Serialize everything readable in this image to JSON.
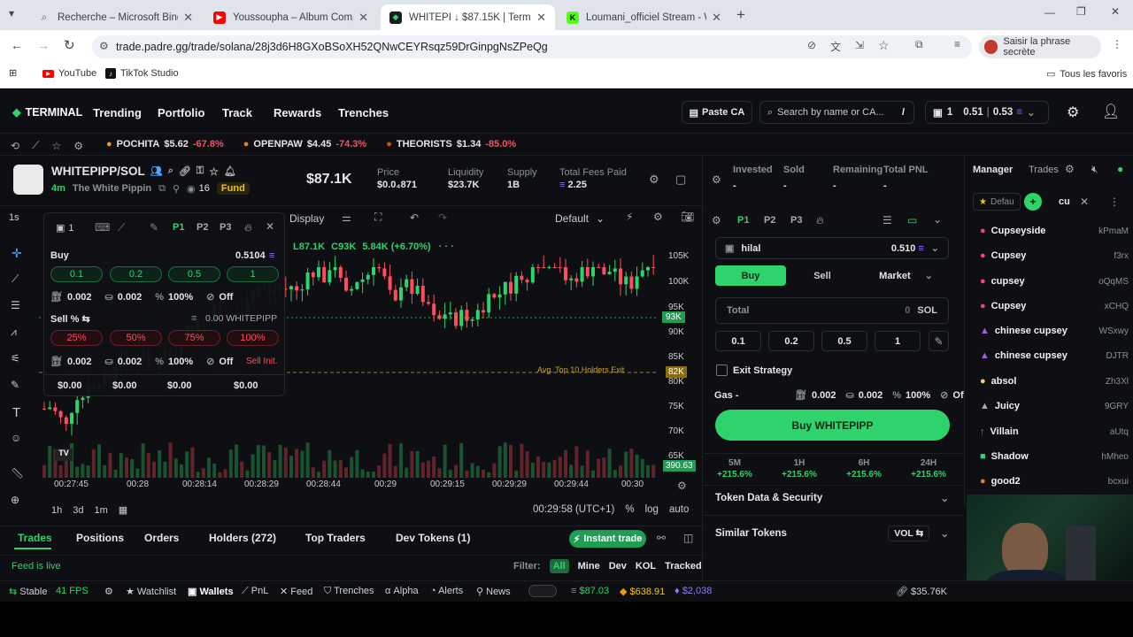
{
  "browser": {
    "tabs": [
      {
        "title": "Recherche – Microsoft Bing",
        "close": "✕"
      },
      {
        "title": "Youssoupha – Album Complet",
        "close": "✕"
      },
      {
        "title": "WHITEPI ↓ $87.15K | Terminal",
        "close": "✕"
      },
      {
        "title": "Loumani_officiel Stream - Watc",
        "close": "✕"
      }
    ],
    "new_tab": "+",
    "url": "trade.padre.gg/trade/solana/28j3d6H8GXoBSoXH52QNwCEYRsqz59DrGinpgNsZPeQg",
    "profile_button": "Saisir la phrase secrète",
    "bookmarks": [
      "YouTube",
      "TikTok Studio"
    ],
    "all_bookmarks": "Tous les favoris"
  },
  "nav": {
    "brand": "TERMINAL",
    "links": [
      "Trending",
      "Portfolio",
      "Track",
      "Rewards",
      "Trenches"
    ],
    "paste": "Paste CA",
    "search_placeholder": "Search by name or CA...",
    "shortcut": "/",
    "wallet_count": "1",
    "sol_balance": "0.51",
    "sol_balance2": "0.53"
  },
  "ticker": [
    {
      "name": "POCHITA",
      "price": "$5.62",
      "change": "-67.8%"
    },
    {
      "name": "OPENPAW",
      "price": "$4.45",
      "change": "-74.3%"
    },
    {
      "name": "THEORISTS",
      "price": "$1.34",
      "change": "-85.0%"
    }
  ],
  "token": {
    "pair": "WHITEPIPP/SOL",
    "age": "4m",
    "name": "The White Pippin",
    "holders_eye": "16",
    "fund": "Fund",
    "mcap": "$87.1K",
    "stats": [
      {
        "label": "Price",
        "value": "$0.0₄871"
      },
      {
        "label": "Liquidity",
        "value": "$23.7K"
      },
      {
        "label": "Supply",
        "value": "1B"
      },
      {
        "label": "Total Fees Paid",
        "value": "2.25"
      }
    ]
  },
  "chart_toolbar": {
    "interval": "1s",
    "display": "Display",
    "template": "Default"
  },
  "chart_legend": {
    "low": "L87.1K",
    "close": "C93K",
    "change": "5.84K (+6.70%)"
  },
  "y_ticks": [
    "105K",
    "100K",
    "95K",
    "90K",
    "85K",
    "80K",
    "75K",
    "70K",
    "65K"
  ],
  "price_tag": "93K",
  "avg_tag": "82K",
  "vol_tag": "390.63",
  "avg_label": "Avg. Top 10 Holders Exit",
  "x_ticks": [
    "00:27:45",
    "00:28",
    "00:28:14",
    "00:28:29",
    "00:28:44",
    "00:29",
    "00:29:15",
    "00:29:29",
    "00:29:44",
    "00:30"
  ],
  "chart_bottom": {
    "ranges": [
      "1h",
      "3d",
      "1m"
    ],
    "time": "00:29:58 (UTC+1)",
    "pct": "%",
    "log": "log",
    "auto": "auto"
  },
  "quick": {
    "count": "1",
    "presets": [
      "P1",
      "P2",
      "P3"
    ],
    "buy_label": "Buy",
    "buy_balance": "0.5104",
    "buy_amounts": [
      "0.1",
      "0.2",
      "0.5",
      "1"
    ],
    "settings": [
      "0.002",
      "0.002",
      "100%",
      "Off"
    ],
    "sell_label": "Sell % ⇆",
    "sell_balance": "0.00 WHITEPIPP",
    "sell_amounts": [
      "25%",
      "50%",
      "75%",
      "100%"
    ],
    "sell_settings": [
      "0.002",
      "0.002",
      "100%",
      "Off"
    ],
    "sell_init": "Sell Init.",
    "values": [
      "$0.00",
      "$0.00",
      "$0.00",
      "$0.00"
    ]
  },
  "bottom_tabs": [
    "Trades",
    "Positions",
    "Orders",
    "Holders (272)",
    "Top Traders",
    "Dev Tokens (1)"
  ],
  "instant_trade": "Instant trade",
  "feed_live": "Feed is live",
  "filter": {
    "label": "Filter:",
    "options": [
      "All",
      "Mine",
      "Dev",
      "KOL",
      "Tracked"
    ]
  },
  "footer": {
    "stable": "Stable",
    "fps": "41 FPS",
    "items": [
      "Watchlist",
      "Wallets",
      "PnL",
      "Feed",
      "Trenches",
      "Alpha",
      "Alerts",
      "News"
    ],
    "sol": "$87.03",
    "eth": "$638.91",
    "other": "$2,038",
    "right": "$35.76K"
  },
  "position": {
    "labels": [
      "Invested",
      "Sold",
      "Remaining",
      "Total PNL"
    ],
    "values": [
      "-",
      "-",
      "-",
      "-"
    ]
  },
  "order": {
    "presets": [
      "P1",
      "P2",
      "P3"
    ],
    "wallet": "hilal",
    "wallet_bal": "0.510",
    "sides": [
      "Buy",
      "Sell"
    ],
    "type": "Market",
    "total_label": "Total",
    "total_value": "0",
    "total_unit": "SOL",
    "amounts": [
      "0.1",
      "0.2",
      "0.5",
      "1"
    ],
    "exit": "Exit Strategy",
    "gas": "Gas -",
    "gas_settings": [
      "0.002",
      "0.002",
      "100%",
      "Off"
    ],
    "buy_button": "Buy WHITEPIPP"
  },
  "timeframes": [
    {
      "label": "5M",
      "change": "+215.6%"
    },
    {
      "label": "1H",
      "change": "+215.6%"
    },
    {
      "label": "6H",
      "change": "+215.6%"
    },
    {
      "label": "24H",
      "change": "+215.6%"
    }
  ],
  "sections": [
    "Token Data & Security",
    "Similar Tokens"
  ],
  "similar_sort": "VOL",
  "manager": {
    "tabs": [
      "Manager",
      "Trades"
    ],
    "filter_default": "Defau",
    "search": "cu",
    "rows": [
      {
        "name": "Cupseyside",
        "addr": "kPmaM"
      },
      {
        "name": "Cupsey",
        "addr": "f3rx"
      },
      {
        "name": "cupsey",
        "addr": "oQqMS"
      },
      {
        "name": "Cupsey",
        "addr": "xCHQ"
      },
      {
        "name": "chinese cupsey",
        "addr": "WSxwy"
      },
      {
        "name": "chinese cupsey",
        "addr": "DJTR"
      },
      {
        "name": "absol",
        "addr": "Zh3Xl"
      },
      {
        "name": "Juicy",
        "addr": "9GRY"
      },
      {
        "name": "Villain",
        "addr": "aUtq"
      },
      {
        "name": "Shadow",
        "addr": "hMheo"
      },
      {
        "name": "good2",
        "addr": "bcxui"
      }
    ]
  },
  "colors": {
    "accent": "#2fd36b",
    "danger": "#ff4d5e",
    "bg": "#0e0f12"
  }
}
